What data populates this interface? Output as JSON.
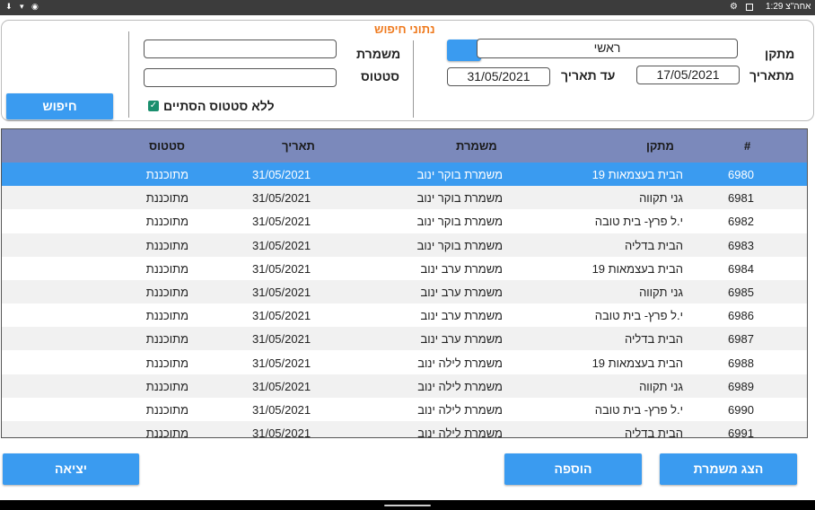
{
  "statusbar": {
    "time": "1:29 אחה\"צ",
    "left_icons": "⬇ ▾ ◉"
  },
  "search": {
    "title": "נתוני חיפוש",
    "facility_label": "מתקן",
    "facility_value": "ראשי",
    "from_date_label": "מתאריך",
    "from_date_value": "17/05/2021",
    "to_date_label": "עד תאריך",
    "to_date_value": "31/05/2021",
    "shift_label": "משמרת",
    "shift_value": "",
    "status_label": "סטטוס",
    "status_value": "",
    "no_closed_status_label": "ללא סטטוס הסתיים",
    "no_closed_status_checked": true,
    "search_button": "חיפוש",
    "accent_color": "#ef7a1e"
  },
  "table": {
    "columns": {
      "num": "#",
      "facility": "מתקן",
      "shift": "משמרת",
      "date": "תאריך",
      "status": "סטטוס"
    },
    "rows": [
      {
        "num": "6980",
        "facility": "הבית בעצמאות 19",
        "shift": "משמרת בוקר ינוב",
        "date": "31/05/2021",
        "status": "מתוכננת",
        "selected": true
      },
      {
        "num": "6981",
        "facility": "גני תקווה",
        "shift": "משמרת בוקר ינוב",
        "date": "31/05/2021",
        "status": "מתוכננת"
      },
      {
        "num": "6982",
        "facility": "י.ל פרץ- בית טובה",
        "shift": "משמרת בוקר ינוב",
        "date": "31/05/2021",
        "status": "מתוכננת"
      },
      {
        "num": "6983",
        "facility": "הבית בדליה",
        "shift": "משמרת בוקר ינוב",
        "date": "31/05/2021",
        "status": "מתוכננת"
      },
      {
        "num": "6984",
        "facility": "הבית בעצמאות 19",
        "shift": "משמרת ערב ינוב",
        "date": "31/05/2021",
        "status": "מתוכננת"
      },
      {
        "num": "6985",
        "facility": "גני תקווה",
        "shift": "משמרת ערב ינוב",
        "date": "31/05/2021",
        "status": "מתוכננת"
      },
      {
        "num": "6986",
        "facility": "י.ל פרץ- בית טובה",
        "shift": "משמרת ערב ינוב",
        "date": "31/05/2021",
        "status": "מתוכננת"
      },
      {
        "num": "6987",
        "facility": "הבית בדליה",
        "shift": "משמרת ערב ינוב",
        "date": "31/05/2021",
        "status": "מתוכננת"
      },
      {
        "num": "6988",
        "facility": "הבית בעצמאות 19",
        "shift": "משמרת לילה ינוב",
        "date": "31/05/2021",
        "status": "מתוכננת"
      },
      {
        "num": "6989",
        "facility": "גני תקווה",
        "shift": "משמרת לילה ינוב",
        "date": "31/05/2021",
        "status": "מתוכננת"
      },
      {
        "num": "6990",
        "facility": "י.ל פרץ- בית טובה",
        "shift": "משמרת לילה ינוב",
        "date": "31/05/2021",
        "status": "מתוכננת"
      },
      {
        "num": "6991",
        "facility": "הבית בדליה",
        "shift": "משמרת לילה ינוב",
        "date": "31/05/2021",
        "status": "מתוכננת"
      }
    ],
    "header_color": "#7b89bb",
    "selected_color": "#3a9bf0"
  },
  "footer": {
    "show_shift_button": "הצג משמרת",
    "add_button": "הוספה",
    "exit_button": "יציאה"
  }
}
